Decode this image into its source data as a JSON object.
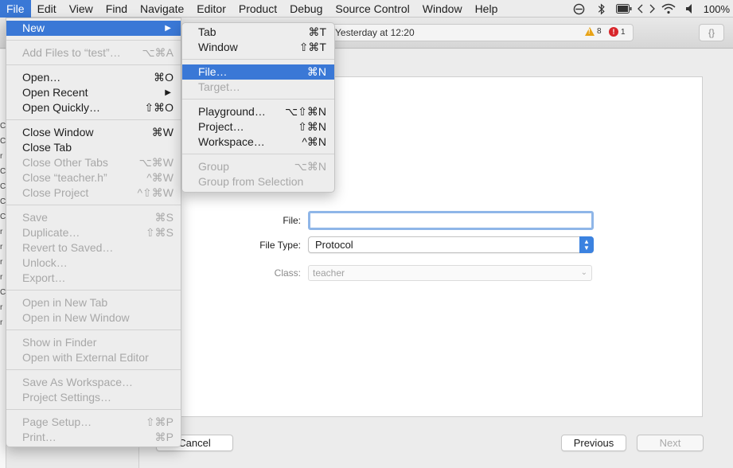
{
  "menubar": {
    "items": [
      "File",
      "Edit",
      "View",
      "Find",
      "Navigate",
      "Editor",
      "Product",
      "Debug",
      "Source Control",
      "Window",
      "Help"
    ],
    "status_icons": [
      "stop-circle-icon",
      "bluetooth-icon",
      "battery-icon",
      "code-bracket-icon",
      "wifi-icon",
      "volume-icon"
    ],
    "battery_percent": "100%"
  },
  "toolbar": {
    "activity_time": "Yesterday at 12:20",
    "warnings": "8",
    "errors": "1",
    "braces": "{}"
  },
  "file_menu": {
    "new": "New",
    "add_files": "Add Files to “test”…",
    "add_files_sc": "⌥⌘A",
    "open": "Open…",
    "open_sc": "⌘O",
    "open_recent": "Open Recent",
    "open_quickly": "Open Quickly…",
    "open_quickly_sc": "⇧⌘O",
    "close_window": "Close Window",
    "close_window_sc": "⌘W",
    "close_tab": "Close Tab",
    "close_other_tabs": "Close Other Tabs",
    "close_other_tabs_sc": "⌥⌘W",
    "close_teacher": "Close “teacher.h”",
    "close_teacher_sc": "^⌘W",
    "close_project": "Close Project",
    "close_project_sc": "^⇧⌘W",
    "save": "Save",
    "save_sc": "⌘S",
    "duplicate": "Duplicate…",
    "duplicate_sc": "⇧⌘S",
    "revert": "Revert to Saved…",
    "unlock": "Unlock…",
    "export": "Export…",
    "open_new_tab": "Open in New Tab",
    "open_new_window": "Open in New Window",
    "show_finder": "Show in Finder",
    "open_external": "Open with External Editor",
    "save_workspace": "Save As Workspace…",
    "project_settings": "Project Settings…",
    "page_setup": "Page Setup…",
    "page_setup_sc": "⇧⌘P",
    "print": "Print…",
    "print_sc": "⌘P"
  },
  "new_menu": {
    "tab": "Tab",
    "tab_sc": "⌘T",
    "window": "Window",
    "window_sc": "⇧⌘T",
    "file": "File…",
    "file_sc": "⌘N",
    "target": "Target…",
    "playground": "Playground…",
    "playground_sc": "⌥⇧⌘N",
    "project": "Project…",
    "project_sc": "⇧⌘N",
    "workspace": "Workspace…",
    "workspace_sc": "^⌘N",
    "group": "Group",
    "group_sc": "⌥⌘N",
    "group_selection": "Group from Selection"
  },
  "sheet": {
    "file_label": "File:",
    "file_value": "",
    "file_type_label": "File Type:",
    "file_type_value": "Protocol",
    "class_label": "Class:",
    "class_value": "teacher",
    "cancel": "Cancel",
    "previous": "Previous",
    "next": "Next"
  },
  "navigator": {
    "cut_glyphs": [
      "C",
      "C",
      "r",
      "C",
      "C",
      "C",
      "C",
      "r",
      "r",
      "r",
      "r",
      "C",
      "r",
      "r"
    ]
  },
  "colors": {
    "highlight": "#3a78d6",
    "focus_ring": "#8fb6e8",
    "warning": "#e8a317",
    "error": "#d8262b"
  }
}
